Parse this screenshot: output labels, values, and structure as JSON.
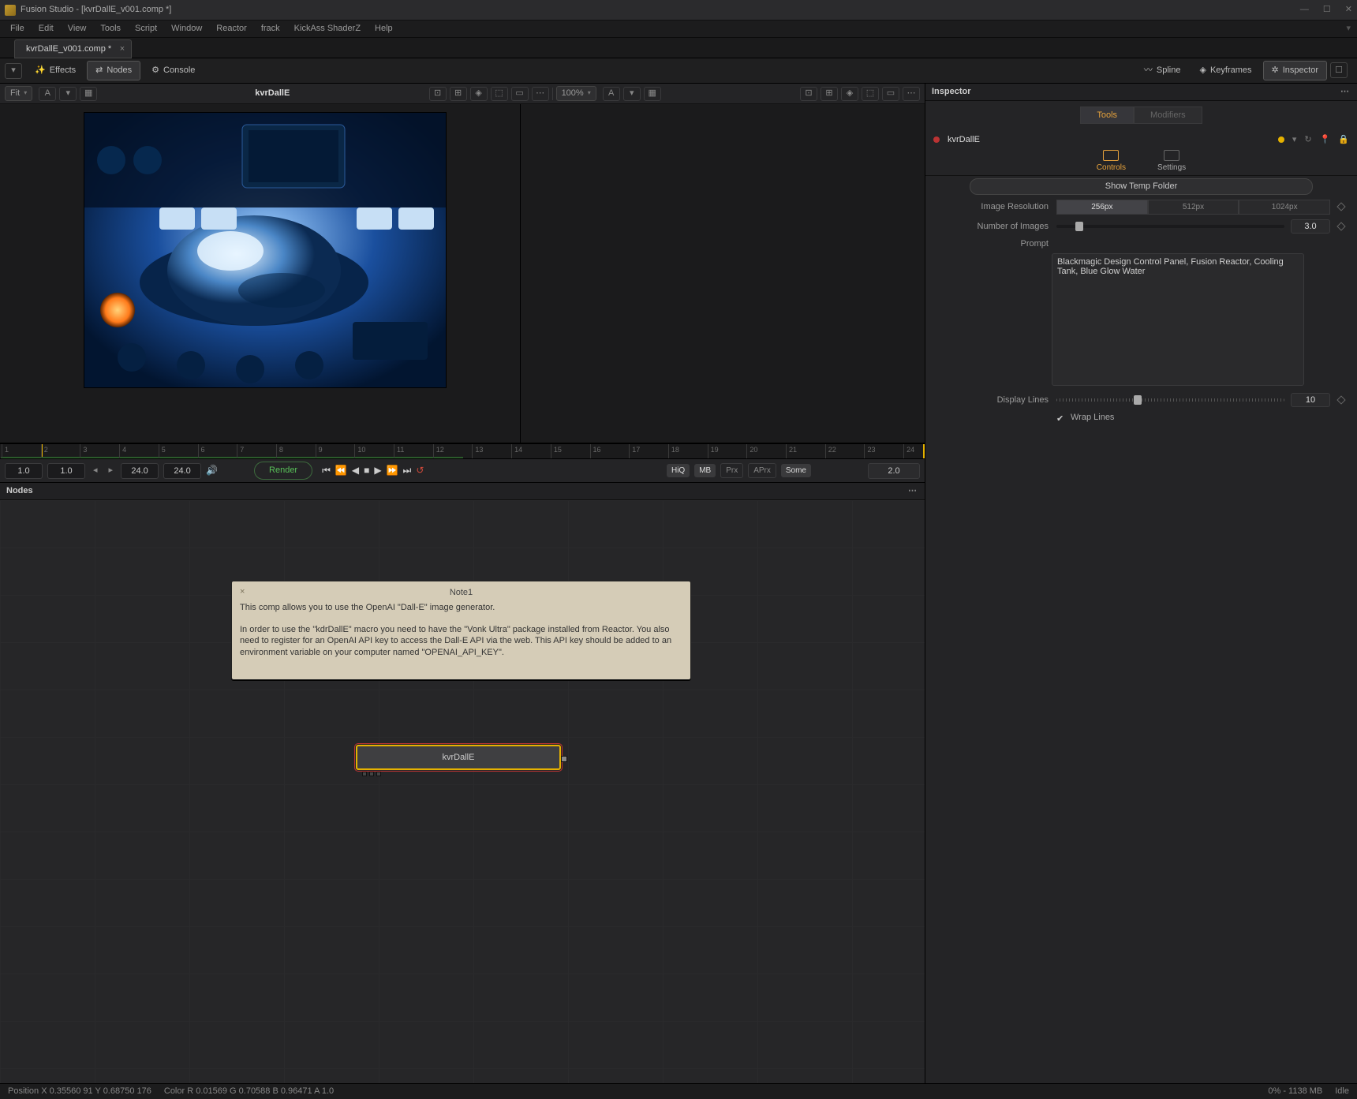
{
  "title": "Fusion Studio - [kvrDallE_v001.comp *]",
  "menu": [
    "File",
    "Edit",
    "View",
    "Tools",
    "Script",
    "Window",
    "Reactor",
    "frack",
    "KickAss ShaderZ",
    "Help"
  ],
  "doc_tab": "kvrDallE_v001.comp *",
  "toolbar": {
    "effects": "Effects",
    "nodes": "Nodes",
    "console": "Console",
    "spline": "Spline",
    "keyframes": "Keyframes",
    "inspector": "Inspector"
  },
  "viewerA": {
    "fit_label": "Fit",
    "crumb": "kvrDallE"
  },
  "viewerB": {
    "zoom_label": "100%"
  },
  "timeline": {
    "ticks": [
      "1",
      "2",
      "3",
      "4",
      "5",
      "6",
      "7",
      "8",
      "9",
      "10",
      "11",
      "12",
      "13",
      "14",
      "15",
      "16",
      "17",
      "18",
      "19",
      "20",
      "21",
      "22",
      "23",
      "24"
    ]
  },
  "transport": {
    "in_frame": "1.0",
    "start": "1.0",
    "end": "24.0",
    "out_frame": "24.0",
    "render": "Render",
    "hiq": "HiQ",
    "mb": "MB",
    "prx": "Prx",
    "aprx": "APrx",
    "some": "Some",
    "current": "2.0"
  },
  "nodes_panel": "Nodes",
  "note": {
    "title": "Note1",
    "line1": "This comp allows you to use the OpenAI \"Dall-E\" image generator.",
    "line2": "In order to use the \"kdrDallE\" macro you need to have the \"Vonk Ultra\" package installed from Reactor. You also need to register for an OpenAI API key to access the Dall-E API via the web. This API key should be added to an environment variable on your computer named \"OPENAI_API_KEY\"."
  },
  "node": {
    "name": "kvrDallE"
  },
  "inspector": {
    "title": "Inspector",
    "tab_tools": "Tools",
    "tab_modifiers": "Modifiers",
    "node_name": "kvrDallE",
    "subtab_controls": "Controls",
    "subtab_settings": "Settings",
    "show_temp": "Show Temp Folder",
    "image_res_label": "Image Resolution",
    "res_opts": [
      "256px",
      "512px",
      "1024px"
    ],
    "num_images_label": "Number of Images",
    "num_images_val": "3.0",
    "prompt_label": "Prompt",
    "prompt_text": "Blackmagic Design Control Panel, Fusion Reactor, Cooling Tank, Blue Glow Water",
    "display_lines_label": "Display Lines",
    "display_lines_val": "10",
    "wrap_lines_label": "Wrap Lines"
  },
  "status": {
    "pos": "Position   X 0.35560    91       Y 0.68750    176",
    "color": "Color  R 0.01569    G 0.70588    B 0.96471    A 1.0",
    "mem": "0% - 1138 MB",
    "idle": "Idle"
  }
}
